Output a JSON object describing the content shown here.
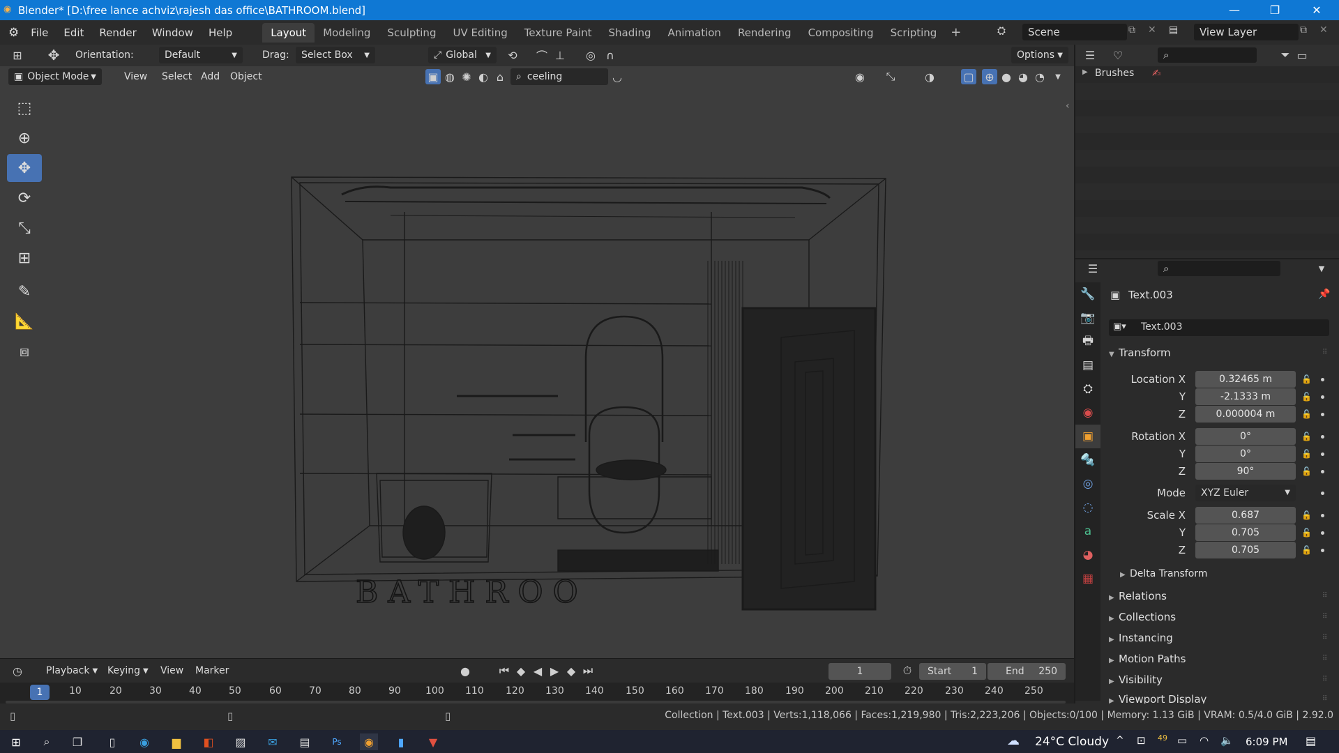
{
  "window": {
    "title": "Blender* [D:\\free lance achviz\\rajesh das office\\BATHROOM.blend]"
  },
  "menu": [
    "File",
    "Edit",
    "Render",
    "Window",
    "Help"
  ],
  "workspaces": [
    "Layout",
    "Modeling",
    "Sculpting",
    "UV Editing",
    "Texture Paint",
    "Shading",
    "Animation",
    "Rendering",
    "Compositing",
    "Scripting"
  ],
  "scene": {
    "label": "Scene",
    "view_layer": "View Layer"
  },
  "header": {
    "orientation_label": "Orientation:",
    "orientation_value": "Default",
    "drag_label": "Drag:",
    "drag_value": "Select Box",
    "transform_space": "Global",
    "options": "Options",
    "mode": "Object Mode",
    "view": "View",
    "select": "Select",
    "add": "Add",
    "object": "Object",
    "search_value": "ceeling"
  },
  "viewport": {
    "floor_text": "BATHROO"
  },
  "outliner": {
    "item": "Brushes"
  },
  "properties": {
    "object_name": "Text.003",
    "data_name": "Text.003",
    "transform": "Transform",
    "location_label": "Location X",
    "loc_x": "0.32465 m",
    "loc_y": "-2.1333 m",
    "loc_z": "0.000004 m",
    "rotation_label": "Rotation X",
    "rot_x": "0°",
    "rot_y": "0°",
    "rot_z": "90°",
    "mode_label": "Mode",
    "mode_value": "XYZ Euler",
    "scale_label": "Scale X",
    "scale_x": "0.687",
    "scale_y": "0.705",
    "scale_z": "0.705",
    "y": "Y",
    "z": "Z",
    "delta": "Delta Transform",
    "sections": [
      "Relations",
      "Collections",
      "Instancing",
      "Motion Paths",
      "Visibility",
      "Viewport Display"
    ]
  },
  "timeline": {
    "playback": "Playback",
    "keying": "Keying",
    "view": "View",
    "marker": "Marker",
    "current_frame": "1",
    "start_label": "Start",
    "start": "1",
    "end_label": "End",
    "end": "250",
    "ticks": [
      "10",
      "20",
      "30",
      "40",
      "50",
      "60",
      "70",
      "80",
      "90",
      "100",
      "110",
      "120",
      "130",
      "140",
      "150",
      "160",
      "170",
      "180",
      "190",
      "200",
      "210",
      "220",
      "230",
      "240",
      "250"
    ],
    "playhead": "1"
  },
  "status": {
    "text": "Collection | Text.003 | Verts:1,118,066 | Faces:1,219,980 | Tris:2,223,206 | Objects:0/100 | Memory: 1.13 GiB | VRAM: 0.5/4.0 GiB | 2.92.0"
  },
  "taskbar": {
    "weather": "24°C  Cloudy",
    "time": "6:09 PM",
    "badge": "49"
  },
  "colors": {
    "accent": "#4772b3",
    "titlebar": "#0f78d4"
  }
}
